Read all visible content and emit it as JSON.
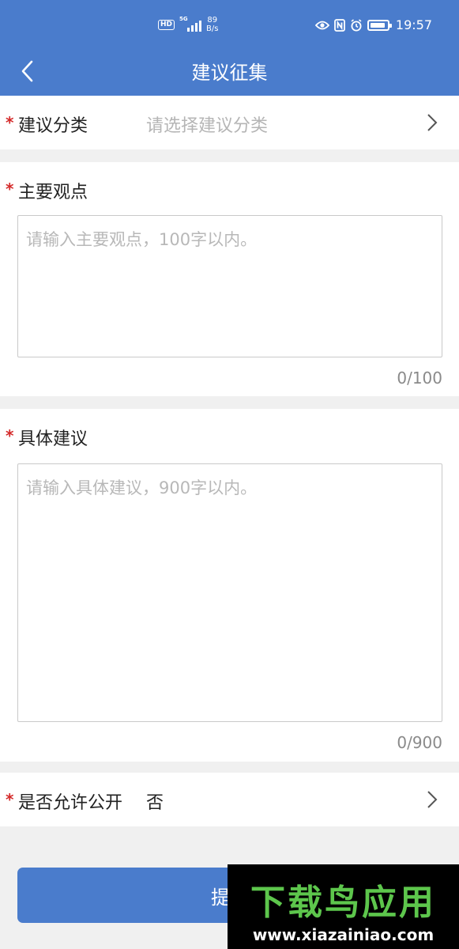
{
  "status_bar": {
    "hd": "HD",
    "network": "5G",
    "speed_value": "89",
    "speed_unit": "B/s",
    "nfc": "N",
    "time": "19:57"
  },
  "nav": {
    "title": "建议征集"
  },
  "form": {
    "required_mark": "*",
    "category": {
      "label": "建议分类",
      "placeholder": "请选择建议分类"
    },
    "main_point": {
      "label": "主要观点",
      "placeholder": "请输入主要观点，100字以内。",
      "counter": "0/100"
    },
    "suggestion": {
      "label": "具体建议",
      "placeholder": "请输入具体建议，900字以内。",
      "counter": "0/900"
    },
    "public": {
      "label": "是否允许公开",
      "value": "否"
    },
    "submit_label": "提交"
  },
  "watermark": {
    "main": "下载鸟应用",
    "url": "www.xiazainiao.com"
  },
  "colors": {
    "primary": "#4a7ccc",
    "required": "#d42a2a",
    "background": "#f0f0f0"
  }
}
